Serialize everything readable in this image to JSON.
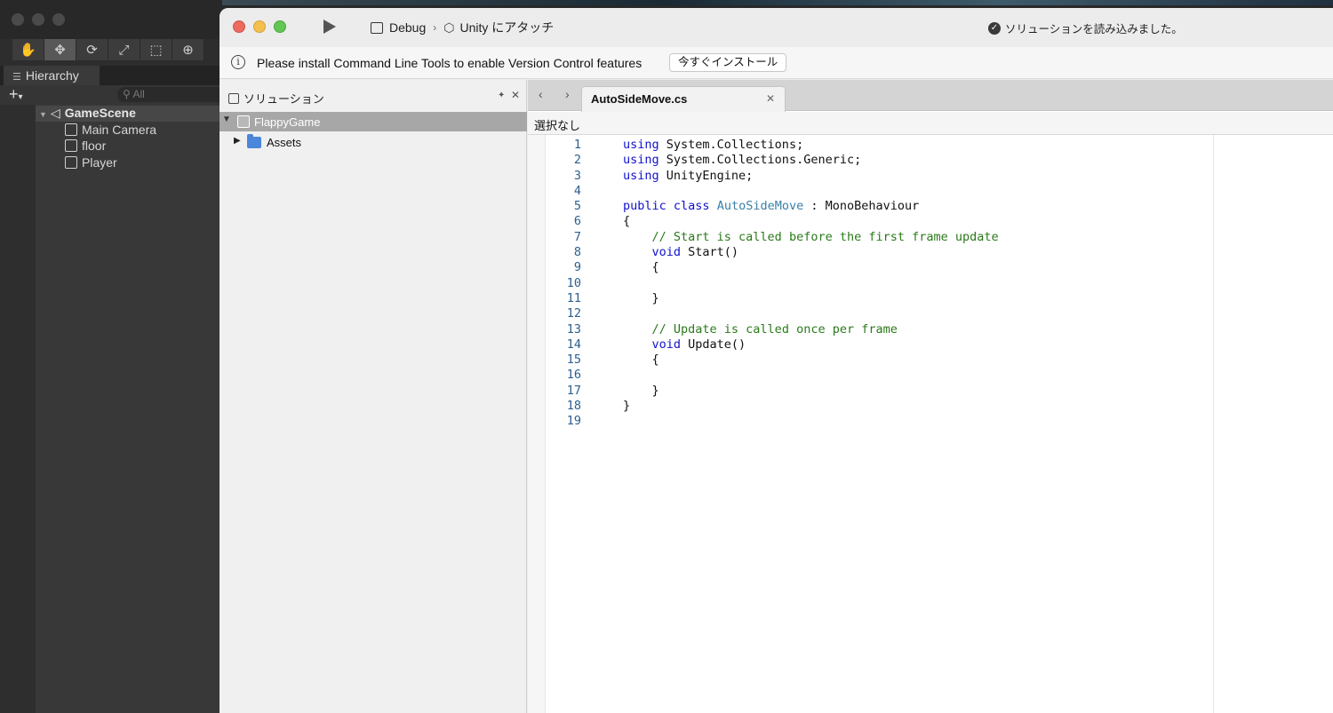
{
  "unity": {
    "toolbar_icons": [
      "hand-icon",
      "move-icon",
      "rotate-icon",
      "scale-icon",
      "rect-icon",
      "transform-icon"
    ],
    "hierarchy": {
      "tab_label": "Hierarchy",
      "add_label": "+",
      "search_placeholder": "All",
      "scene": "GameScene",
      "objects": [
        "Main Camera",
        "floor",
        "Player"
      ]
    }
  },
  "vs": {
    "run_config": "Debug",
    "target": "Unity にアタッチ",
    "status": "ソリューションを読み込みました。",
    "infobar": {
      "message": "Please install Command Line Tools to enable Version Control features",
      "button": "今すぐインストール"
    },
    "solution_pane": {
      "title": "ソリューション",
      "root": "FlappyGame",
      "children": [
        "Assets"
      ]
    },
    "editor": {
      "tab_title": "AutoSideMove.cs",
      "breadcrumb": "選択なし",
      "code": [
        {
          "n": "1",
          "text": "using System.Collections;"
        },
        {
          "n": "2",
          "text": "using System.Collections.Generic;"
        },
        {
          "n": "3",
          "text": "using UnityEngine;"
        },
        {
          "n": "4",
          "text": ""
        },
        {
          "n": "5",
          "text": "public class AutoSideMove : MonoBehaviour"
        },
        {
          "n": "6",
          "text": "{"
        },
        {
          "n": "7",
          "text": "    // Start is called before the first frame update"
        },
        {
          "n": "8",
          "text": "    void Start()"
        },
        {
          "n": "9",
          "text": "    {"
        },
        {
          "n": "10",
          "text": ""
        },
        {
          "n": "11",
          "text": "    }"
        },
        {
          "n": "12",
          "text": ""
        },
        {
          "n": "13",
          "text": "    // Update is called once per frame"
        },
        {
          "n": "14",
          "text": "    void Update()"
        },
        {
          "n": "15",
          "text": "    {"
        },
        {
          "n": "16",
          "text": ""
        },
        {
          "n": "17",
          "text": "    }"
        },
        {
          "n": "18",
          "text": "}"
        },
        {
          "n": "19",
          "text": ""
        }
      ]
    }
  }
}
